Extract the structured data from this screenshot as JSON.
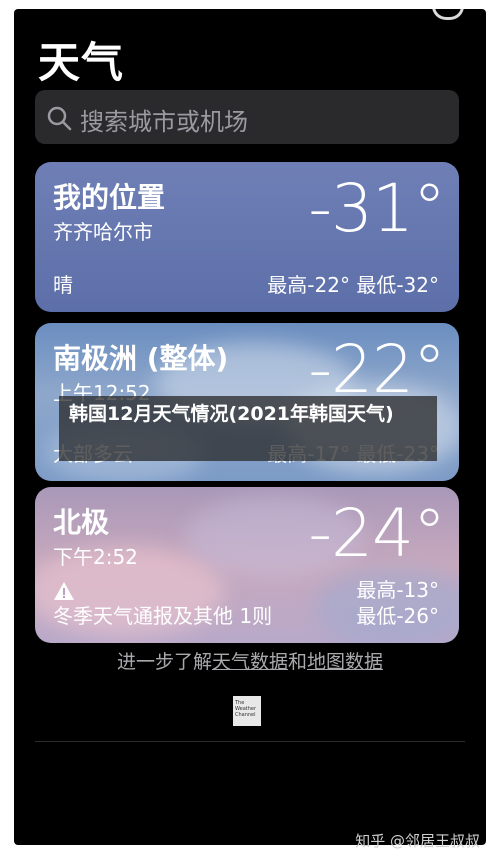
{
  "app": {
    "title": "天气"
  },
  "search": {
    "placeholder": "搜索城市或机场"
  },
  "cards": [
    {
      "location": "我的位置",
      "subtitle": "齐齐哈尔市",
      "temperature": "-31°",
      "condition": "晴",
      "hilo": "最高-22°  最低-32°"
    },
    {
      "location": "南极洲 (整体)",
      "subtitle": "上午12:52",
      "temperature": "-22°",
      "condition": "大部多云",
      "hilo": "最高-17°  最低-23°"
    },
    {
      "location": "北极",
      "subtitle": "下午2:52",
      "temperature": "-24°",
      "alert": "冬季天气通报及其他 1则",
      "high": "最高-13°",
      "low": "最低-26°"
    }
  ],
  "overlay": {
    "text": "韩国12月天气情况(2021年韩国天气)"
  },
  "footer": {
    "prefix": "进一步了解",
    "link1": "天气数据",
    "mid": "和",
    "link2": "地图数据",
    "logo_text": "The Weather Channel"
  },
  "watermark": "知乎 @邻居王叔叔",
  "icons": {
    "search": "magnifier-icon",
    "warning": "warning-triangle-icon",
    "logo": "weather-channel-logo"
  }
}
